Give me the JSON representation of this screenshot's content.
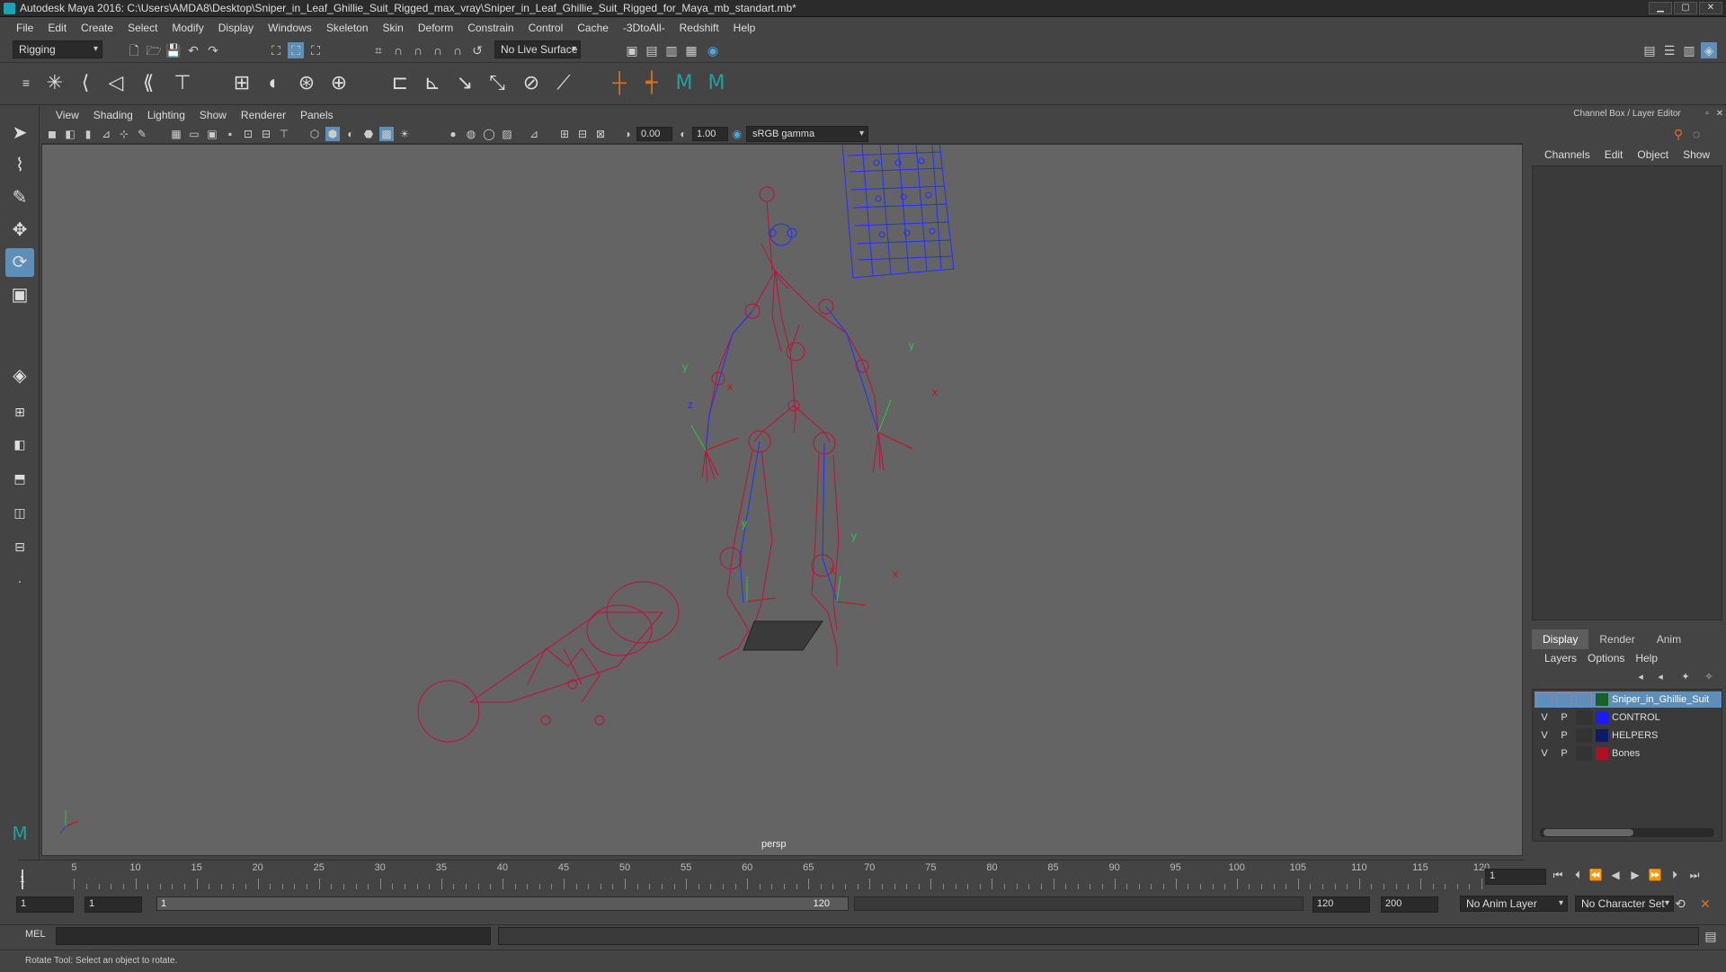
{
  "window": {
    "title": "Autodesk Maya 2016: C:\\Users\\AMDA8\\Desktop\\Sniper_in_Leaf_Ghillie_Suit_Rigged_max_vray\\Sniper_in_Leaf_Ghillie_Suit_Rigged_for_Maya_mb_standart.mb*",
    "minimize": "▁",
    "maximize": "▢",
    "close": "✕"
  },
  "menubar": [
    "File",
    "Edit",
    "Create",
    "Select",
    "Modify",
    "Display",
    "Windows",
    "Skeleton",
    "Skin",
    "Deform",
    "Constrain",
    "Control",
    "Cache",
    "-3DtoAll-",
    "Redshift",
    "Help"
  ],
  "statusline": {
    "mode": "Rigging",
    "live_surface": "No Live Surface"
  },
  "viewport": {
    "menu": [
      "View",
      "Shading",
      "Lighting",
      "Show",
      "Renderer",
      "Panels"
    ],
    "exposure": "0.00",
    "gamma": "1.00",
    "colorspace": "sRGB gamma",
    "camera_label": "persp",
    "axis_y": "y",
    "axis_x": "x",
    "axis_z": "z"
  },
  "channel_box": {
    "header": "Channel Box / Layer Editor",
    "menu": [
      "Channels",
      "Edit",
      "Object",
      "Show"
    ]
  },
  "layer_editor": {
    "tabs": [
      "Display",
      "Render",
      "Anim"
    ],
    "active_tab": "Display",
    "menu": [
      "Layers",
      "Options",
      "Help"
    ],
    "layers": [
      {
        "v": "",
        "p": "",
        "name": "Sniper_in_Ghillie_Suit",
        "color": "#1a5e2a",
        "selected": true
      },
      {
        "v": "V",
        "p": "P",
        "name": "CONTROL",
        "color": "#1a1aff",
        "selected": false
      },
      {
        "v": "V",
        "p": "P",
        "name": "HELPERS",
        "color": "#0c1a6e",
        "selected": false
      },
      {
        "v": "V",
        "p": "P",
        "name": "Bones",
        "color": "#b01020",
        "selected": false
      }
    ]
  },
  "timeline": {
    "ticks": [
      "5",
      "10",
      "15",
      "20",
      "25",
      "30",
      "35",
      "40",
      "45",
      "50",
      "55",
      "60",
      "65",
      "70",
      "75",
      "80",
      "85",
      "90",
      "95",
      "100",
      "105",
      "110",
      "115",
      "120"
    ],
    "current_frame_marker": "1",
    "current_frame": "1"
  },
  "range": {
    "start": "1",
    "playback_start": "1",
    "slider_start": "1",
    "slider_end": "120",
    "playback_end": "120",
    "end": "200",
    "anim_layer": "No Anim Layer",
    "character_set": "No Character Set"
  },
  "cmdline": {
    "label": "MEL"
  },
  "helpline": {
    "text": "Rotate Tool: Select an object to rotate."
  },
  "colors": {
    "wire_red": "#c0103a",
    "wire_blue": "#2030ff",
    "accent": "#5d8fb8"
  }
}
